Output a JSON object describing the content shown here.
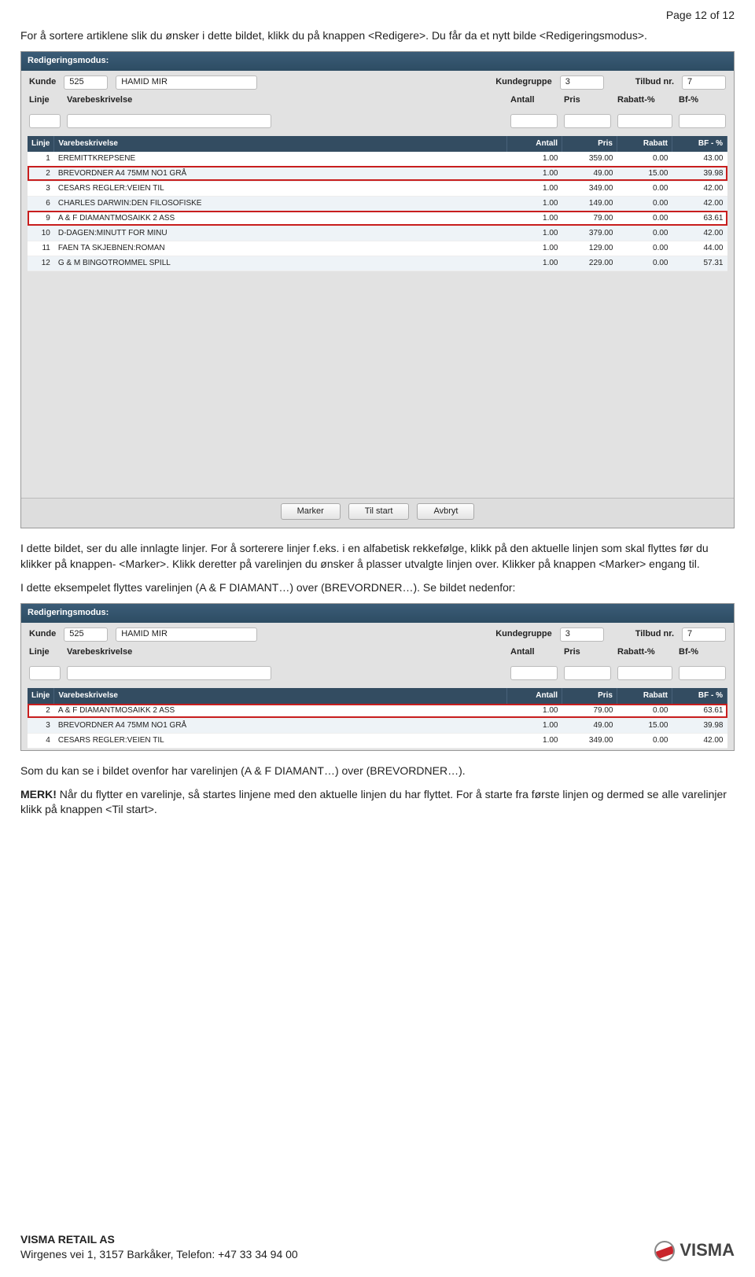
{
  "pageHeader": "Page 12 of 12",
  "body": {
    "p1a": "For å sortere artiklene slik du ønsker i dette bildet, klikk du på knappen <Redigere>. Du får da et nytt bilde <Redigeringsmodus>.",
    "p2": "I dette bildet, ser du alle innlagte linjer. For å sorterere linjer f.eks. i en alfabetisk rekkefølge, klikk på den aktuelle linjen som skal flyttes før du klikker på knappen- <Marker>. Klikk deretter på varelinjen du ønsker å plasser utvalgte linjen over. Klikker på knappen <Marker> engang til.",
    "p3": "I dette eksempelet flyttes varelinjen (A & F DIAMANT…) over (BREVORDNER…). Se bildet nedenfor:",
    "p4": "Som du kan se i bildet ovenfor har varelinjen (A & F DIAMANT…) over (BREVORDNER…).",
    "p5lbl": "MERK!",
    "p5": " Når du flytter en varelinje, så startes linjene med den aktuelle linjen du har flyttet. For å starte fra første linjen og dermed se alle varelinjer klikk på knappen <Til start>."
  },
  "shot": {
    "title": "Redigeringsmodus:",
    "labels": {
      "kunde": "Kunde",
      "kundegruppe": "Kundegruppe",
      "tilbudnr": "Tilbud nr.",
      "linje": "Linje",
      "vare": "Varebeskrivelse",
      "antall": "Antall",
      "pris": "Pris",
      "rabatt": "Rabatt-%",
      "bf": "Bf-%"
    },
    "kundeId": "525",
    "kundeNavn": "HAMID MIR",
    "kundegruppe": "3",
    "tilbudnr": "7",
    "th": {
      "linje": "Linje",
      "vare": "Varebeskrivelse",
      "antall": "Antall",
      "pris": "Pris",
      "rabatt": "Rabatt",
      "bf": "BF - %"
    },
    "buttons": {
      "marker": "Marker",
      "tilstart": "Til start",
      "avbryt": "Avbryt"
    }
  },
  "rows1": [
    {
      "l": "1",
      "v": "EREMITTKREPSENE",
      "a": "1.00",
      "p": "359.00",
      "r": "0.00",
      "b": "43.00",
      "hl": false
    },
    {
      "l": "2",
      "v": "BREVORDNER A4 75MM NO1 GRÅ",
      "a": "1.00",
      "p": "49.00",
      "r": "15.00",
      "b": "39.98",
      "hl": true
    },
    {
      "l": "3",
      "v": "CESARS REGLER:VEIEN TIL",
      "a": "1.00",
      "p": "349.00",
      "r": "0.00",
      "b": "42.00",
      "hl": false
    },
    {
      "l": "6",
      "v": "CHARLES DARWIN:DEN FILOSOFISKE",
      "a": "1.00",
      "p": "149.00",
      "r": "0.00",
      "b": "42.00",
      "hl": false
    },
    {
      "l": "9",
      "v": "A & F DIAMANTMOSAIKK 2 ASS",
      "a": "1.00",
      "p": "79.00",
      "r": "0.00",
      "b": "63.61",
      "hl": true
    },
    {
      "l": "10",
      "v": "D-DAGEN:MINUTT FOR MINU",
      "a": "1.00",
      "p": "379.00",
      "r": "0.00",
      "b": "42.00",
      "hl": false
    },
    {
      "l": "11",
      "v": "FAEN TA SKJEBNEN:ROMAN",
      "a": "1.00",
      "p": "129.00",
      "r": "0.00",
      "b": "44.00",
      "hl": false
    },
    {
      "l": "12",
      "v": "G & M BINGOTROMMEL SPILL",
      "a": "1.00",
      "p": "229.00",
      "r": "0.00",
      "b": "57.31",
      "hl": false
    }
  ],
  "rows2": [
    {
      "l": "2",
      "v": "A & F DIAMANTMOSAIKK 2 ASS",
      "a": "1.00",
      "p": "79.00",
      "r": "0.00",
      "b": "63.61",
      "hl": true
    },
    {
      "l": "3",
      "v": "BREVORDNER A4 75MM NO1 GRÅ",
      "a": "1.00",
      "p": "49.00",
      "r": "15.00",
      "b": "39.98",
      "hl": false
    },
    {
      "l": "4",
      "v": "CESARS REGLER:VEIEN TIL",
      "a": "1.00",
      "p": "349.00",
      "r": "0.00",
      "b": "42.00",
      "hl": false
    }
  ],
  "footer": {
    "company": "VISMA RETAIL AS",
    "addr": "Wirgenes vei 1, 3157 Barkåker, Telefon: +47 33 34 94 00",
    "brand": "VISMA"
  }
}
